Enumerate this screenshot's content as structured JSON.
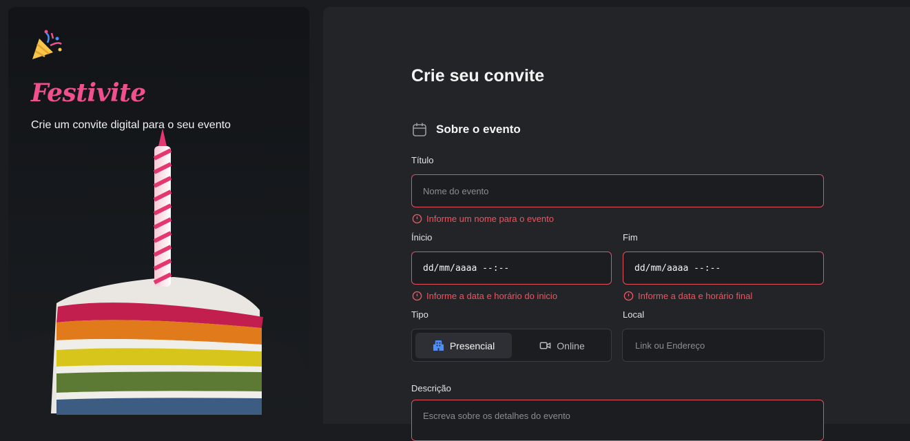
{
  "brand": {
    "name": "Festivite",
    "tagline": "Crie um convite digital para o seu evento"
  },
  "form": {
    "title": "Crie seu convite",
    "section_title": "Sobre o evento",
    "titulo": {
      "label": "Título",
      "placeholder": "Nome do evento",
      "error": "Informe um nome para o evento"
    },
    "inicio": {
      "label": "Ínicio",
      "value": "dd/mm/aaaa --:--",
      "error": "Informe a data e horário do inicio"
    },
    "fim": {
      "label": "Fim",
      "value": "dd/mm/aaaa --:--",
      "error": "Informe a data e horário final"
    },
    "tipo": {
      "label": "Tipo",
      "options": [
        "Presencial",
        "Online"
      ],
      "selected": "Presencial"
    },
    "local": {
      "label": "Local",
      "placeholder": "Link ou Endereço"
    },
    "descricao": {
      "label": "Descrição",
      "placeholder": "Escreva sobre os detalhes do evento"
    }
  },
  "colors": {
    "accent": "#f0518e",
    "error": "#f0535e",
    "tipo_icon": "#4e8ef7"
  },
  "icons": [
    "party-popper-icon",
    "calendar-icon",
    "alert-circle-icon",
    "building-icon",
    "video-icon"
  ]
}
